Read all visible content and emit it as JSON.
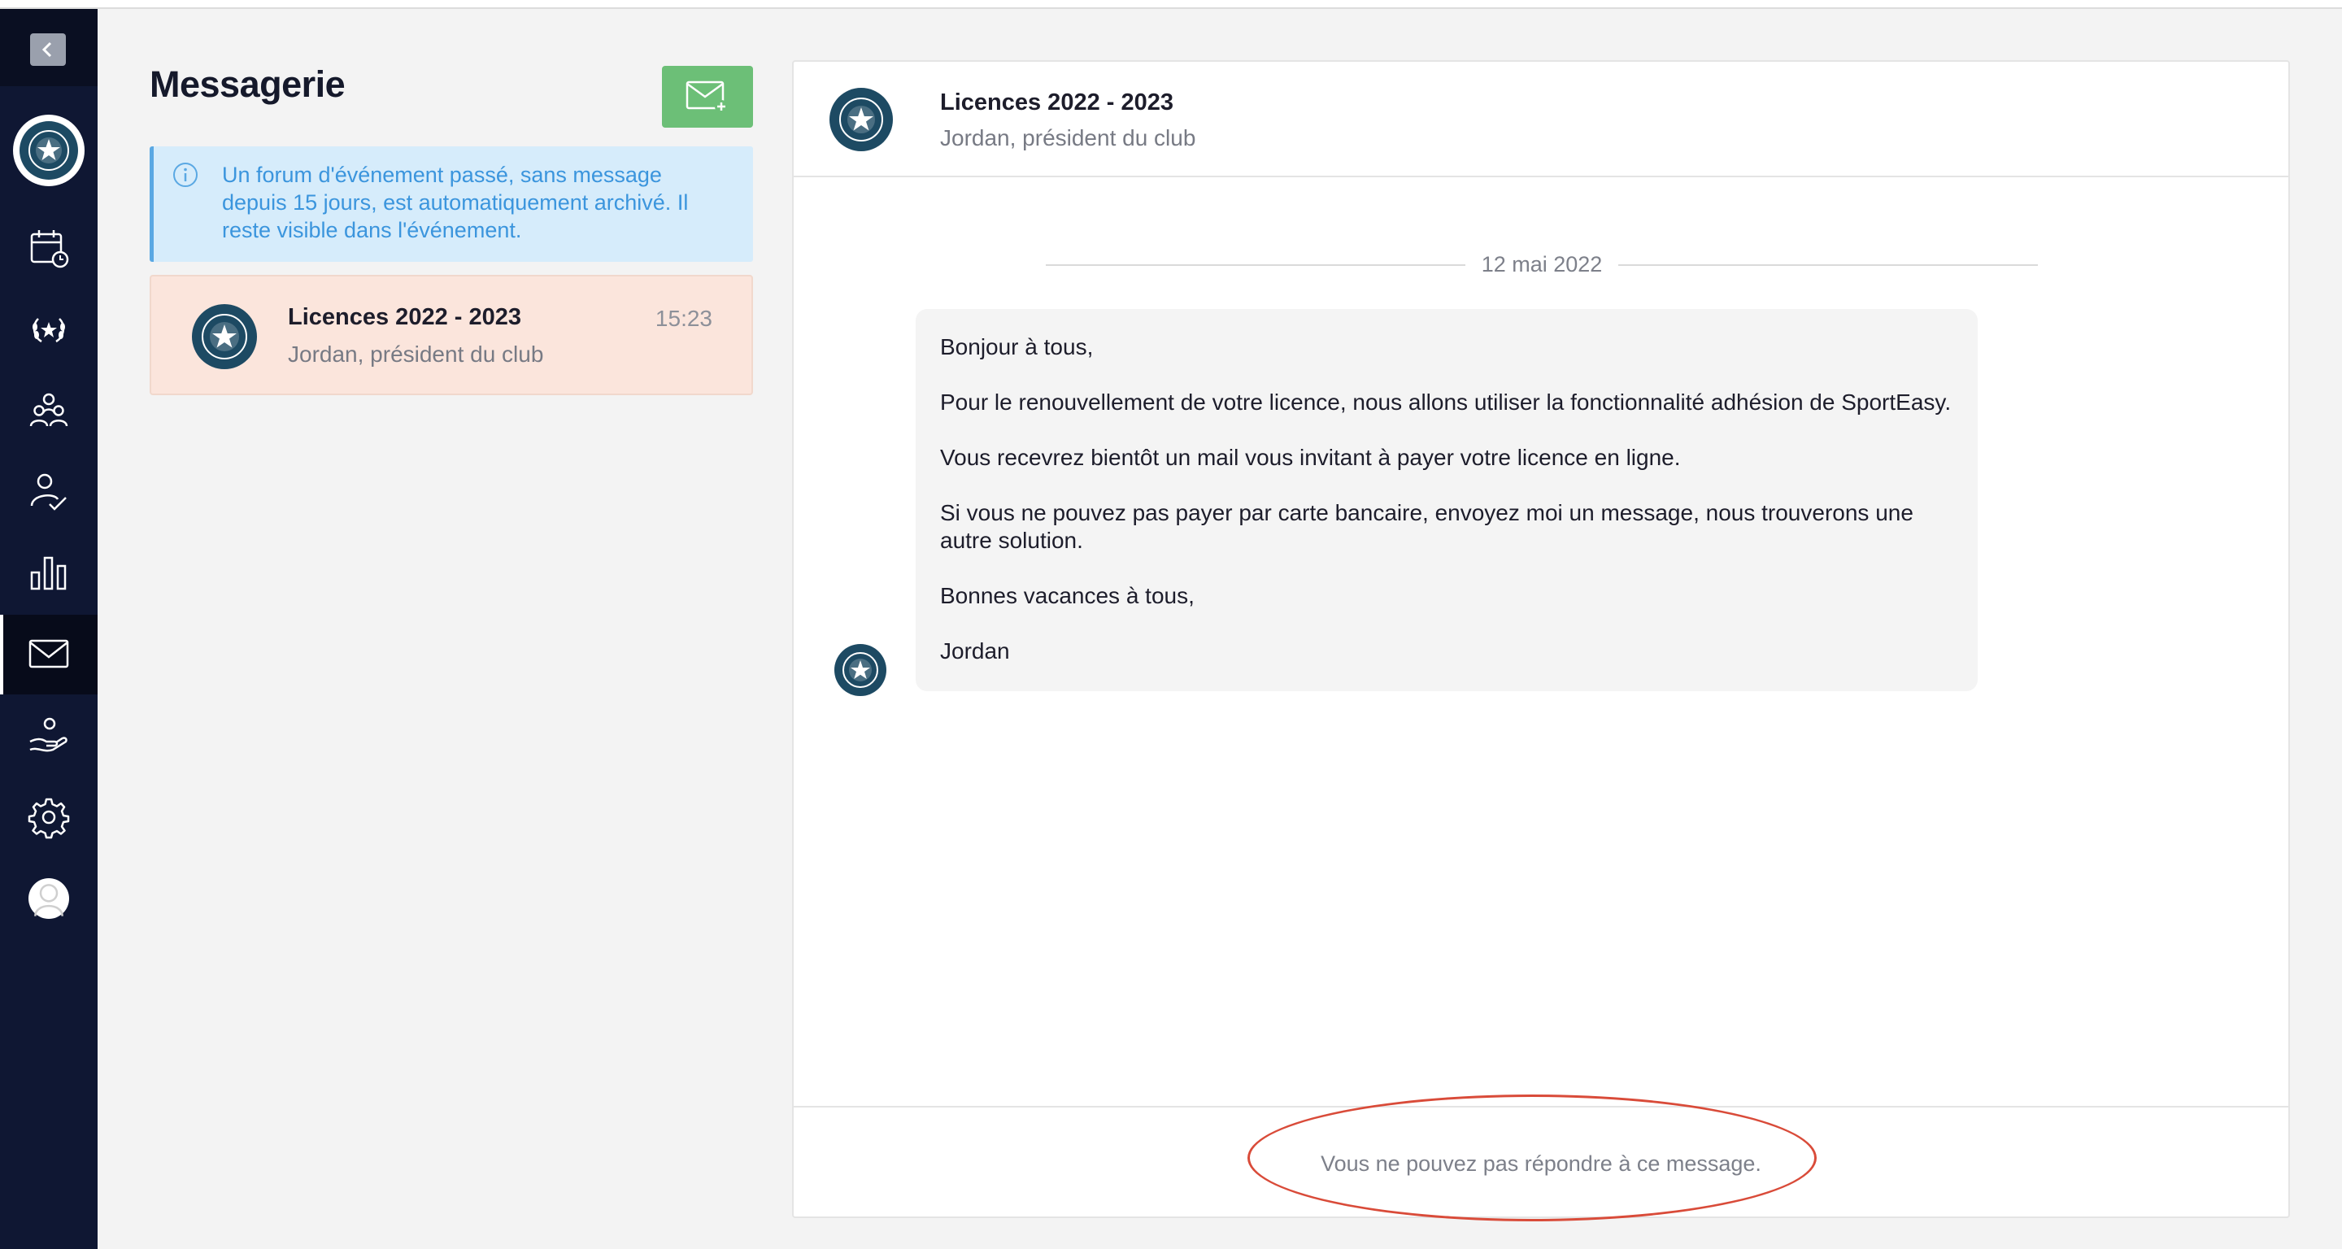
{
  "sidebar": {
    "nav": [
      {
        "name": "calendar-icon"
      },
      {
        "name": "trophy-laurel-icon"
      },
      {
        "name": "team-members-icon"
      },
      {
        "name": "attendance-check-icon"
      },
      {
        "name": "statistics-bars-icon"
      },
      {
        "name": "mail-icon",
        "active": true
      },
      {
        "name": "helping-hand-icon"
      },
      {
        "name": "settings-gear-icon"
      },
      {
        "name": "user-avatar-icon"
      }
    ]
  },
  "messagerie": {
    "title": "Messagerie",
    "info_text": "Un forum d'événement passé, sans message depuis 15 jours, est automatiquement archivé. Il reste visible dans l'événement.",
    "conversations": [
      {
        "title": "Licences 2022 - 2023",
        "subtitle": "Jordan, président du club",
        "time": "15:23",
        "selected": true
      }
    ]
  },
  "thread": {
    "title": "Licences 2022 - 2023",
    "subtitle": "Jordan, président du club",
    "date": "12 mai 2022",
    "message_paragraphs": [
      "Bonjour à tous,",
      "Pour le renouvellement de votre licence, nous allons utiliser la fonctionnalité adhésion de SportEasy.",
      "Vous recevrez bientôt un mail vous invitant à payer votre licence en ligne.",
      "Si vous ne pouvez pas payer par carte bancaire, envoyez moi un message, nous trouverons une autre solution.",
      "Bonnes vacances à tous,",
      "Jordan"
    ],
    "footer_notice": "Vous ne pouvez pas répondre à ce message."
  },
  "colors": {
    "sidebar_bg": "#0f1733",
    "compose_green": "#6cbf77",
    "info_blue": "#3b95dd",
    "selected_conv_bg": "#fbe5dc",
    "club_badge": "#1d4a63",
    "annotation_red": "#d94b39"
  }
}
